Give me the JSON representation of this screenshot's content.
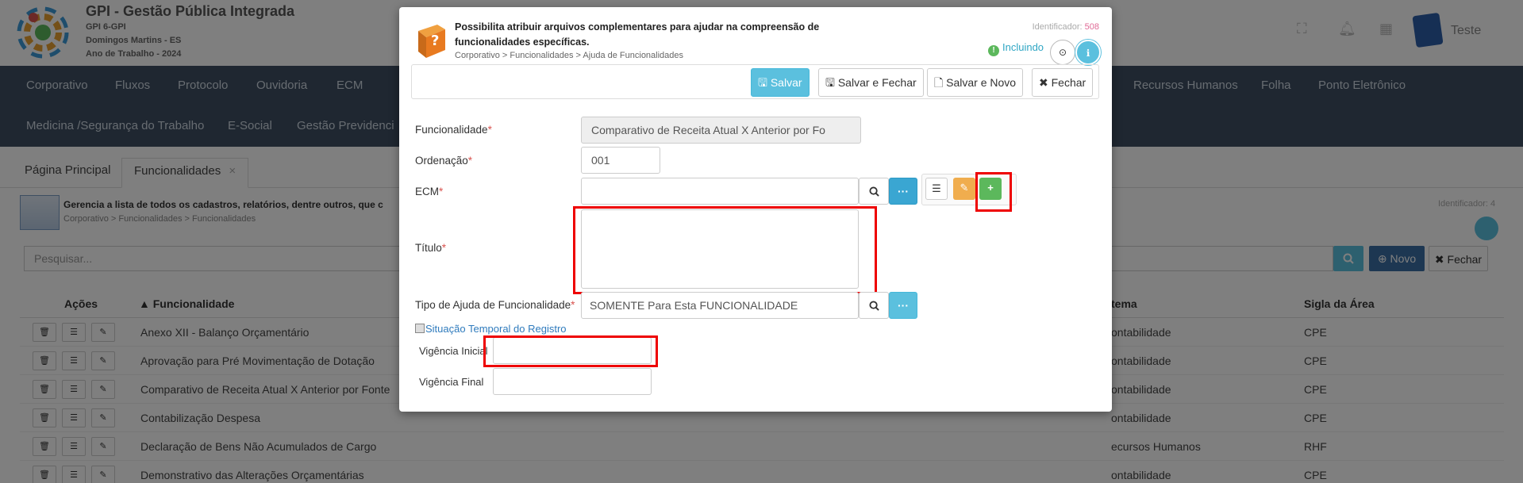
{
  "app": {
    "title": "GPI - Gestão Pública Integrada",
    "sub1": "GPI 6-GPI",
    "sub2": "Domingos Martins - ES",
    "sub3": "Ano de Trabalho - 2024",
    "user": "Teste"
  },
  "menu": {
    "row1": [
      "Corporativo",
      "Fluxos",
      "Protocolo",
      "Ouvidoria",
      "ECM"
    ],
    "row1_right": [
      "Recursos Humanos",
      "Folha",
      "Ponto Eletrônico"
    ],
    "row2": [
      "Medicina /Segurança do Trabalho",
      "E-Social",
      "Gestão Previdenci"
    ]
  },
  "tabs": {
    "home": "Página Principal",
    "current": "Funcionalidades",
    "close": "×"
  },
  "page": {
    "desc": "Gerencia a lista de todos os cadastros, relatórios, dentre outros, que c",
    "breadcrumb": "Corporativo > Funcionalidades > Funcionalidades",
    "ident": "Identificador: 4",
    "search_placeholder": "Pesquisar...",
    "novo": "Novo",
    "fechar": "Fechar"
  },
  "grid": {
    "headers": {
      "acoes": "Ações",
      "funcionalidade": "▲ Funcionalidade",
      "sistema": "tema",
      "sigla": "Sigla da Área"
    },
    "rows": [
      {
        "name": "Anexo XII - Balanço Orçamentário",
        "sistema": "ontabilidade",
        "sigla": "CPE"
      },
      {
        "name": "Aprovação para Pré Movimentação de Dotação",
        "sistema": "ontabilidade",
        "sigla": "CPE"
      },
      {
        "name": "Comparativo de Receita Atual X Anterior por Fonte",
        "sistema": "ontabilidade",
        "sigla": "CPE"
      },
      {
        "name": "Contabilização Despesa",
        "sistema": "ontabilidade",
        "sigla": "CPE"
      },
      {
        "name": "Declaração de Bens Não Acumulados de Cargo",
        "sistema": "ecursos Humanos",
        "sigla": "RHF"
      },
      {
        "name": "Demonstrativo das Alterações Orçamentárias",
        "sistema": "ontabilidade",
        "sigla": "CPE"
      }
    ]
  },
  "modal": {
    "description": "Possibilita atribuir arquivos complementares para ajudar na compreensão de funcionalidades específicas.",
    "breadcrumb": "Corporativo > Funcionalidades > Ajuda de Funcionalidades",
    "ident_label": "Identificador:",
    "ident_value": "508",
    "status": "Incluindo",
    "toolbar": {
      "salvar": "Salvar",
      "salvar_fechar": "Salvar e Fechar",
      "salvar_novo": "Salvar e Novo",
      "fechar": "Fechar"
    },
    "fields": {
      "funcionalidade_label": "Funcionalidade",
      "funcionalidade_value": "Comparativo de Receita Atual X Anterior por Fo",
      "ordenacao_label": "Ordenação",
      "ordenacao_value": "001",
      "ecm_label": "ECM",
      "titulo_label": "Título",
      "tipo_label": "Tipo de Ajuda de Funcionalidade",
      "tipo_value": "SOMENTE Para Esta FUNCIONALIDADE",
      "required_mark": "*"
    },
    "section": "Situação Temporal do Registro",
    "vigencia_inicial": "Vigência Inicial",
    "vigencia_final": "Vigência Final"
  },
  "icons": {
    "search": "search-icon",
    "ellipsis": "ellipsis-icon",
    "list": "list-icon",
    "pencil": "pencil-icon",
    "plus": "plus-icon",
    "trash": "trash-icon"
  },
  "colors": {
    "menubar": "#3e4f63",
    "primary": "#5bc0de",
    "blue_btn": "#3aa6d2",
    "orange_btn": "#f0ad4e",
    "green_btn": "#5cb85c",
    "highlight": "#e00000",
    "required": "#d9534f"
  }
}
